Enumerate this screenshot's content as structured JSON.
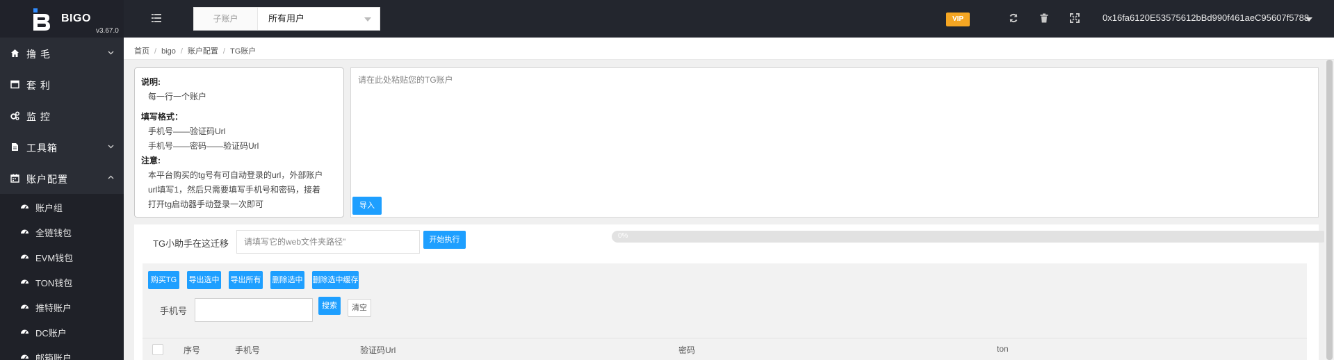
{
  "header": {
    "brand": "BIGO",
    "version": "v3.67.0",
    "account_select": {
      "label": "子账户",
      "value": "所有用户"
    },
    "vip_badge": "VIP",
    "wallet_address": "0x16fa6120E53575612bBd990f461aeC95607f5788",
    "icons": [
      "menu-list-icon",
      "refresh-icon",
      "trash-icon",
      "fullscreen-icon",
      "chevron-down-icon"
    ],
    "colors": {
      "topbar": "#23262e",
      "vip": "#f5a623"
    }
  },
  "sidebar": {
    "items": [
      {
        "label": "撸 毛",
        "icon": "home-icon",
        "expandable": true,
        "expanded": false
      },
      {
        "label": "套 利",
        "icon": "window-icon",
        "expandable": false
      },
      {
        "label": "监 控",
        "icon": "cogs-icon",
        "expandable": false
      },
      {
        "label": "工具箱",
        "icon": "file-icon",
        "expandable": true,
        "expanded": false
      },
      {
        "label": "账户配置",
        "icon": "calendar-icon",
        "expandable": true,
        "expanded": true
      }
    ],
    "sub_items": [
      {
        "label": "账户组",
        "icon": "dashboard-icon"
      },
      {
        "label": "全链钱包",
        "icon": "dashboard-icon"
      },
      {
        "label": "EVM钱包",
        "icon": "dashboard-icon"
      },
      {
        "label": "TON钱包",
        "icon": "dashboard-icon"
      },
      {
        "label": "推特账户",
        "icon": "dashboard-icon"
      },
      {
        "label": "DC账户",
        "icon": "dashboard-icon"
      },
      {
        "label": "邮箱账户",
        "icon": "dashboard-icon"
      }
    ]
  },
  "breadcrumb": [
    "首页",
    "bigo",
    "账户配置",
    "TG账户"
  ],
  "instructions": {
    "explain_title": "说明:",
    "explain_lines": [
      "每一行一个账户"
    ],
    "format_title": "填写格式：",
    "format_lines": [
      "手机号——验证码Url",
      "手机号——密码——验证码Url"
    ],
    "note_title": "注意:",
    "note_lines": [
      "本平台购买的tg号有可自动登录的url，外部账户",
      "url填写1，然后只需要填写手机号和密码，接着",
      "打开tg启动器手动登录一次即可"
    ]
  },
  "paste": {
    "placeholder": "请在此处粘贴您的TG账户",
    "import_label": "导入"
  },
  "migrate": {
    "label": "TG小助手在这迁移",
    "placeholder": "请填写它的web文件夹路径\"",
    "run_label": "开始执行",
    "progress": 0,
    "progress_text": "0%"
  },
  "toolbar": {
    "buy": "购买TG",
    "export_selected": "导出选中",
    "export_all": "导出所有",
    "delete_selected": "删除选中",
    "delete_selected_cache": "删除选中缓存"
  },
  "search": {
    "phone_label": "手机号",
    "search_label": "搜索",
    "clear_label": "清空"
  },
  "table": {
    "columns": [
      "序号",
      "手机号",
      "验证码Url",
      "密码",
      "ton"
    ]
  }
}
